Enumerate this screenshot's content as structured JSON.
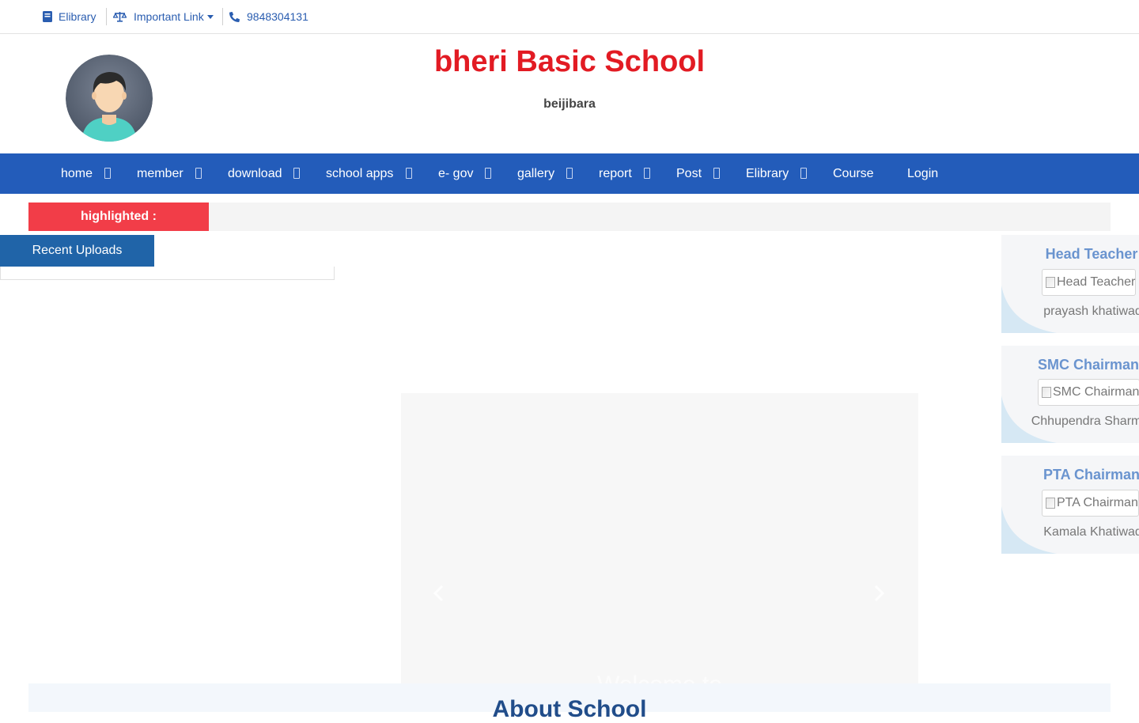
{
  "topbar": {
    "elibrary_label": "Elibrary",
    "important_link_label": "Important Link",
    "phone": "9848304131",
    "accent_color": "#2a5db0"
  },
  "header": {
    "school_name": "bheri Basic School",
    "address": "beijibara",
    "title_color": "#e21b23"
  },
  "nav": {
    "background": "#235cba",
    "items": [
      {
        "label": "home"
      },
      {
        "label": "member"
      },
      {
        "label": "download"
      },
      {
        "label": "school apps"
      },
      {
        "label": "e- gov"
      },
      {
        "label": "gallery"
      },
      {
        "label": "report"
      },
      {
        "label": "Post"
      },
      {
        "label": "Elibrary"
      },
      {
        "label": "Course"
      },
      {
        "label": "Login"
      }
    ]
  },
  "highlight": {
    "label": "highlighted :",
    "label_color": "#f23d48"
  },
  "recent_uploads": {
    "tab_label": "Recent Uploads"
  },
  "slider": {
    "prev_icon": "chevron-left-icon",
    "next_icon": "chevron-right-icon",
    "caption": "Welcome to"
  },
  "about": {
    "title": "About School"
  },
  "officials": [
    {
      "role": "Head Teacher",
      "image_alt": "Head Teacher",
      "name": "prayash khatiwada"
    },
    {
      "role": "SMC Chairman",
      "image_alt": "SMC Chairman",
      "name": "Chhupendra Sharma"
    },
    {
      "role": "PTA Chairman",
      "image_alt": "PTA Chairman",
      "name": "Kamala Khatiwada"
    }
  ]
}
